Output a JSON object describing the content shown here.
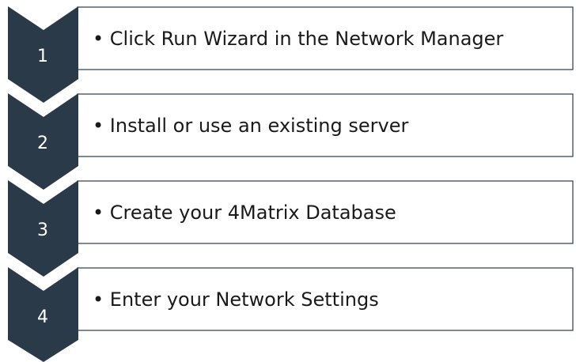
{
  "theme": {
    "chevron_color": "#2b3a48",
    "card_border_color": "#2b3a48",
    "text_color": "#1a1a1a"
  },
  "steps": [
    {
      "number": "1",
      "text": "• Click Run Wizard in the Network Manager"
    },
    {
      "number": "2",
      "text": "• Install or use an existing server"
    },
    {
      "number": "3",
      "text": "• Create your 4Matrix Database"
    },
    {
      "number": "4",
      "text": "• Enter your Network Settings"
    }
  ]
}
